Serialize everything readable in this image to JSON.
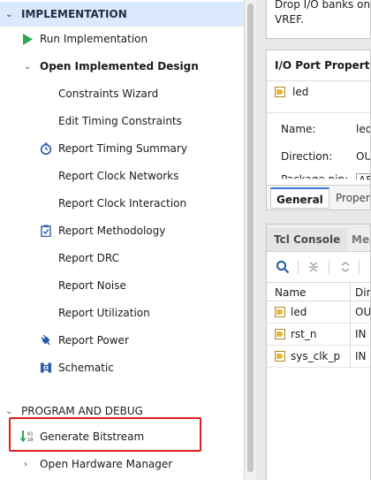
{
  "flow_navigator": {
    "implementation": {
      "header": "IMPLEMENTATION",
      "run": "Run Implementation",
      "open_design": "Open Implemented Design",
      "items": [
        {
          "label": "Constraints Wizard",
          "icon": "none"
        },
        {
          "label": "Edit Timing Constraints",
          "icon": "none"
        },
        {
          "label": "Report Timing Summary",
          "icon": "clock-icon"
        },
        {
          "label": "Report Clock Networks",
          "icon": "none"
        },
        {
          "label": "Report Clock Interaction",
          "icon": "none"
        },
        {
          "label": "Report Methodology",
          "icon": "clipboard-check-icon"
        },
        {
          "label": "Report DRC",
          "icon": "none"
        },
        {
          "label": "Report Noise",
          "icon": "none"
        },
        {
          "label": "Report Utilization",
          "icon": "none"
        },
        {
          "label": "Report Power",
          "icon": "power-plug-icon"
        },
        {
          "label": "Schematic",
          "icon": "schematic-icon"
        }
      ]
    },
    "program_debug": {
      "header": "PROGRAM AND DEBUG",
      "generate": "Generate Bitstream",
      "open_hw": "Open Hardware Manager"
    }
  },
  "top_panel": {
    "line1": "Drop I/O banks on v",
    "line2": "VREF."
  },
  "io_port_properties": {
    "title": "I/O Port Properties",
    "object": "led",
    "props": [
      {
        "name": "Name:",
        "value": "led"
      },
      {
        "name": "Direction:",
        "value": "OU"
      },
      {
        "name": "Package pin:",
        "value": "AF"
      }
    ],
    "tabs": {
      "active": "General",
      "inactive": "Propert"
    }
  },
  "console": {
    "tabs": [
      "Tcl Console",
      "Mes"
    ],
    "columns": [
      "Name",
      "Dir"
    ],
    "rows": [
      {
        "name": "led",
        "dir": "OU"
      },
      {
        "name": "rst_n",
        "dir": "IN"
      },
      {
        "name": "sys_clk_p",
        "dir": "IN"
      }
    ]
  },
  "colors": {
    "section_highlight": "#dbe9fc",
    "run_green": "#2fa84f",
    "annotation_red": "#e02020",
    "icon_blue": "#2a5caa",
    "port_yellow": "#e8b63c"
  }
}
